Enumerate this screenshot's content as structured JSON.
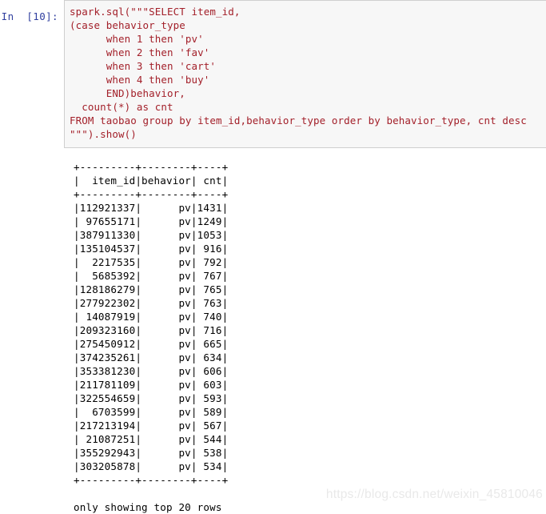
{
  "cell": {
    "prompt_label": "In  [10]:",
    "prompt_color": "#303f9f",
    "code_color": "#a3202a",
    "cell_background": "#f7f7f7",
    "cell_border": "#cfcfcf",
    "source": "spark.sql(\"\"\"SELECT item_id,\n(case behavior_type\n      when 1 then 'pv'\n      when 2 then 'fav'\n      when 3 then 'cart'\n      when 4 then 'buy'\n      END)behavior,\n  count(*) as cnt\nFROM taobao group by item_id,behavior_type order by behavior_type, cnt desc\n\"\"\").show()"
  },
  "output": {
    "separator": "+---------+--------+----+",
    "header_row": "| item_id|behavior| cnt|",
    "footer_note": "only showing top 20 rows",
    "columns": [
      "item_id",
      "behavior",
      "cnt"
    ],
    "rows": [
      {
        "item_id": "112921337",
        "behavior": "pv",
        "cnt": "1431"
      },
      {
        "item_id": "97655171",
        "behavior": "pv",
        "cnt": "1249"
      },
      {
        "item_id": "387911330",
        "behavior": "pv",
        "cnt": "1053"
      },
      {
        "item_id": "135104537",
        "behavior": "pv",
        "cnt": "916"
      },
      {
        "item_id": "2217535",
        "behavior": "pv",
        "cnt": "792"
      },
      {
        "item_id": "5685392",
        "behavior": "pv",
        "cnt": "767"
      },
      {
        "item_id": "128186279",
        "behavior": "pv",
        "cnt": "765"
      },
      {
        "item_id": "277922302",
        "behavior": "pv",
        "cnt": "763"
      },
      {
        "item_id": "14087919",
        "behavior": "pv",
        "cnt": "740"
      },
      {
        "item_id": "209323160",
        "behavior": "pv",
        "cnt": "716"
      },
      {
        "item_id": "275450912",
        "behavior": "pv",
        "cnt": "665"
      },
      {
        "item_id": "374235261",
        "behavior": "pv",
        "cnt": "634"
      },
      {
        "item_id": "353381230",
        "behavior": "pv",
        "cnt": "606"
      },
      {
        "item_id": "211781109",
        "behavior": "pv",
        "cnt": "603"
      },
      {
        "item_id": "322554659",
        "behavior": "pv",
        "cnt": "593"
      },
      {
        "item_id": "6703599",
        "behavior": "pv",
        "cnt": "589"
      },
      {
        "item_id": "217213194",
        "behavior": "pv",
        "cnt": "567"
      },
      {
        "item_id": "21087251",
        "behavior": "pv",
        "cnt": "544"
      },
      {
        "item_id": "355292943",
        "behavior": "pv",
        "cnt": "538"
      },
      {
        "item_id": "303205878",
        "behavior": "pv",
        "cnt": "534"
      }
    ]
  },
  "watermark": {
    "text": "https://blog.csdn.net/weixin_45810046",
    "color": "#e9e9e9"
  }
}
